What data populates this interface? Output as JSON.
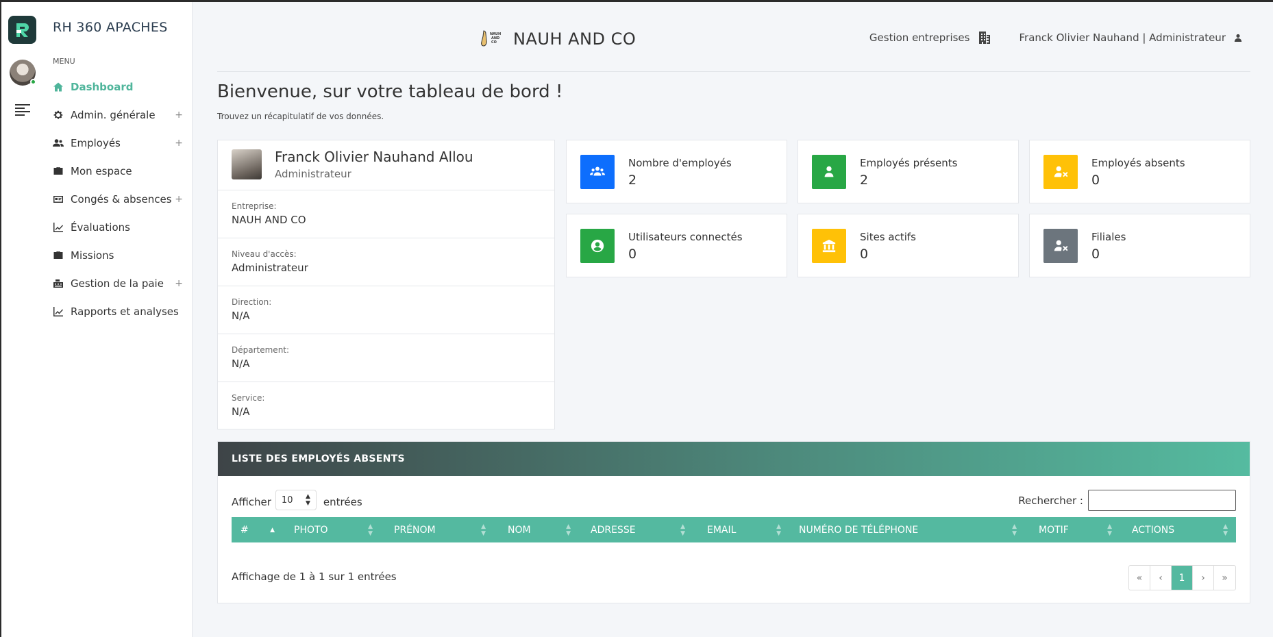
{
  "app": {
    "title": "RH 360 APACHES",
    "accent": "#4fb59b",
    "logo_color": "#1f3a3a"
  },
  "sidebar": {
    "menu_label": "MENU",
    "items": [
      {
        "label": "Dashboard",
        "icon": "home-icon",
        "active": true,
        "expandable": false
      },
      {
        "label": "Admin. générale",
        "icon": "gear-icon",
        "active": false,
        "expandable": true
      },
      {
        "label": "Employés",
        "icon": "users-icon",
        "active": false,
        "expandable": true
      },
      {
        "label": "Mon espace",
        "icon": "briefcase-icon",
        "active": false,
        "expandable": false
      },
      {
        "label": "Congés & absences",
        "icon": "id-card-icon",
        "active": false,
        "expandable": true
      },
      {
        "label": "Évaluations",
        "icon": "chart-line-icon",
        "active": false,
        "expandable": false
      },
      {
        "label": "Missions",
        "icon": "briefcase-icon",
        "active": false,
        "expandable": false
      },
      {
        "label": "Gestion de la paie",
        "icon": "cash-register-icon",
        "active": false,
        "expandable": true
      },
      {
        "label": "Rapports et analyses",
        "icon": "chart-line-icon",
        "active": false,
        "expandable": false
      }
    ],
    "expand_symbol": "+"
  },
  "header": {
    "company_name": "NAUH AND CO",
    "company_logo_text": "NAUH AND CO",
    "gestion_label": "Gestion entreprises",
    "user_label": "Franck Olivier Nauhand | Administrateur"
  },
  "welcome": {
    "title": "Bienvenue, sur votre tableau de bord !",
    "subtitle": "Trouvez un récapitulatif de vos données."
  },
  "profile": {
    "name": "Franck Olivier Nauhand Allou",
    "role": "Administrateur",
    "fields": [
      {
        "label": "Entreprise:",
        "value": "NAUH AND CO"
      },
      {
        "label": "Niveau d'accès:",
        "value": "Administrateur"
      },
      {
        "label": "Direction:",
        "value": "N/A"
      },
      {
        "label": "Département:",
        "value": "N/A"
      },
      {
        "label": "Service:",
        "value": "N/A"
      }
    ]
  },
  "stats": [
    {
      "label": "Nombre d'employés",
      "value": "2",
      "color": "#0d6efd",
      "icon": "users-group-icon"
    },
    {
      "label": "Employés présents",
      "value": "2",
      "color": "#28a745",
      "icon": "user-icon"
    },
    {
      "label": "Employés absents",
      "value": "0",
      "color": "#ffc107",
      "icon": "user-times-icon"
    },
    {
      "label": "Utilisateurs connectés",
      "value": "0",
      "color": "#28a745",
      "icon": "user-circle-icon"
    },
    {
      "label": "Sites actifs",
      "value": "0",
      "color": "#ffc107",
      "icon": "bank-icon"
    },
    {
      "label": "Filiales",
      "value": "0",
      "color": "#6c757d",
      "icon": "user-times-icon"
    }
  ],
  "absent_list": {
    "title": "LISTE DES EMPLOYÉS ABSENTS",
    "show_label": "Afficher",
    "show_value": "10",
    "entries_label": "entrées",
    "search_label": "Rechercher :",
    "search_value": "",
    "columns": [
      "#",
      "PHOTO",
      "PRÉNOM",
      "NOM",
      "ADRESSE",
      "EMAIL",
      "NUMÉRO DE TÉLÉPHONE",
      "MOTIF",
      "ACTIONS"
    ],
    "info": "Affichage de 1 à 1 sur 1 entrées",
    "pagination": [
      "«",
      "‹",
      "1",
      "›",
      "»"
    ],
    "current_page": "1"
  }
}
